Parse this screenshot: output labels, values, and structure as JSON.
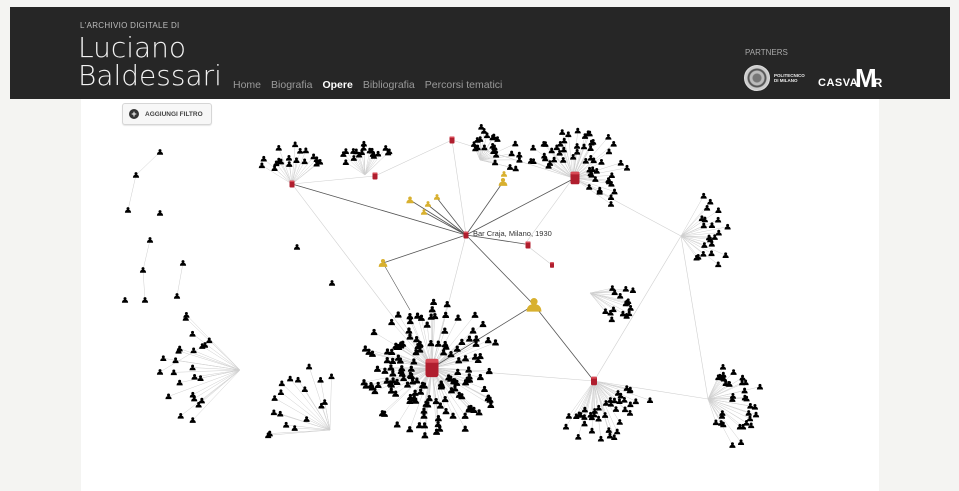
{
  "header": {
    "archive_label": "L'ARCHIVIO DIGITALE DI",
    "title_line1": "Luciano",
    "title_line2": "Baldessari",
    "nav": [
      {
        "label": "Home",
        "active": false
      },
      {
        "label": "Biografia",
        "active": false
      },
      {
        "label": "Opere",
        "active": true
      },
      {
        "label": "Bibliografia",
        "active": false
      },
      {
        "label": "Percorsi tematici",
        "active": false
      }
    ],
    "partners_label": "PARTNERS",
    "partners": {
      "polimi_line1": "POLITECNICO",
      "polimi_line2": "DI MILANO",
      "casva": "CASVA",
      "mr_big": "M",
      "mr_small": "R"
    }
  },
  "toolbar": {
    "add_filter_label": "AGGIUNGI FILTRO",
    "add_filter_icon": "plus-circle-icon"
  },
  "graph": {
    "tooltip": "Bar Craja, Milano, 1930",
    "colors": {
      "work": "#b01e2e",
      "person_highlight": "#d8b02f",
      "person": "#dcdcdc",
      "edge": "#cfcfcf",
      "edge_highlight": "#555555"
    }
  }
}
